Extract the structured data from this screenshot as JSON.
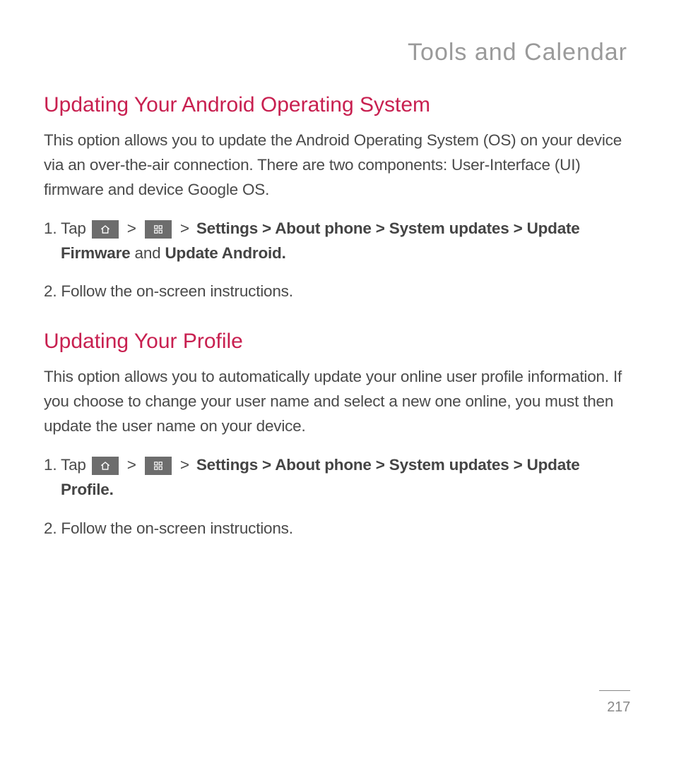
{
  "header": {
    "title": "Tools and Calendar"
  },
  "section1": {
    "heading": "Updating Your Android Operating System",
    "intro": "This option allows you to update the Android Operating System (OS) on your device via an over-the-air connection. There are two components: User-Interface (UI) firmware and device Google OS.",
    "step1_num": "1. ",
    "step1_tap": "Tap ",
    "step1_sep1": " > ",
    "step1_sep2": " > ",
    "step1_path": "Settings > About phone > System updates > Update Firmware",
    "step1_and": " and ",
    "step1_path2": "Update Android.",
    "step2_num": "2. ",
    "step2_text": "Follow the on-screen instructions."
  },
  "section2": {
    "heading": "Updating Your Profile",
    "intro": "This option allows you to automatically update your online user profile information. If you choose to change your user name and select a new one online, you must then update the user name on your device.",
    "step1_num": "1. ",
    "step1_tap": "Tap ",
    "step1_sep1": " > ",
    "step1_sep2": " > ",
    "step1_path": "Settings > About phone > System updates > Update Profile.",
    "step2_num": "2. ",
    "step2_text": "Follow the on-screen instructions."
  },
  "footer": {
    "page": "217"
  }
}
